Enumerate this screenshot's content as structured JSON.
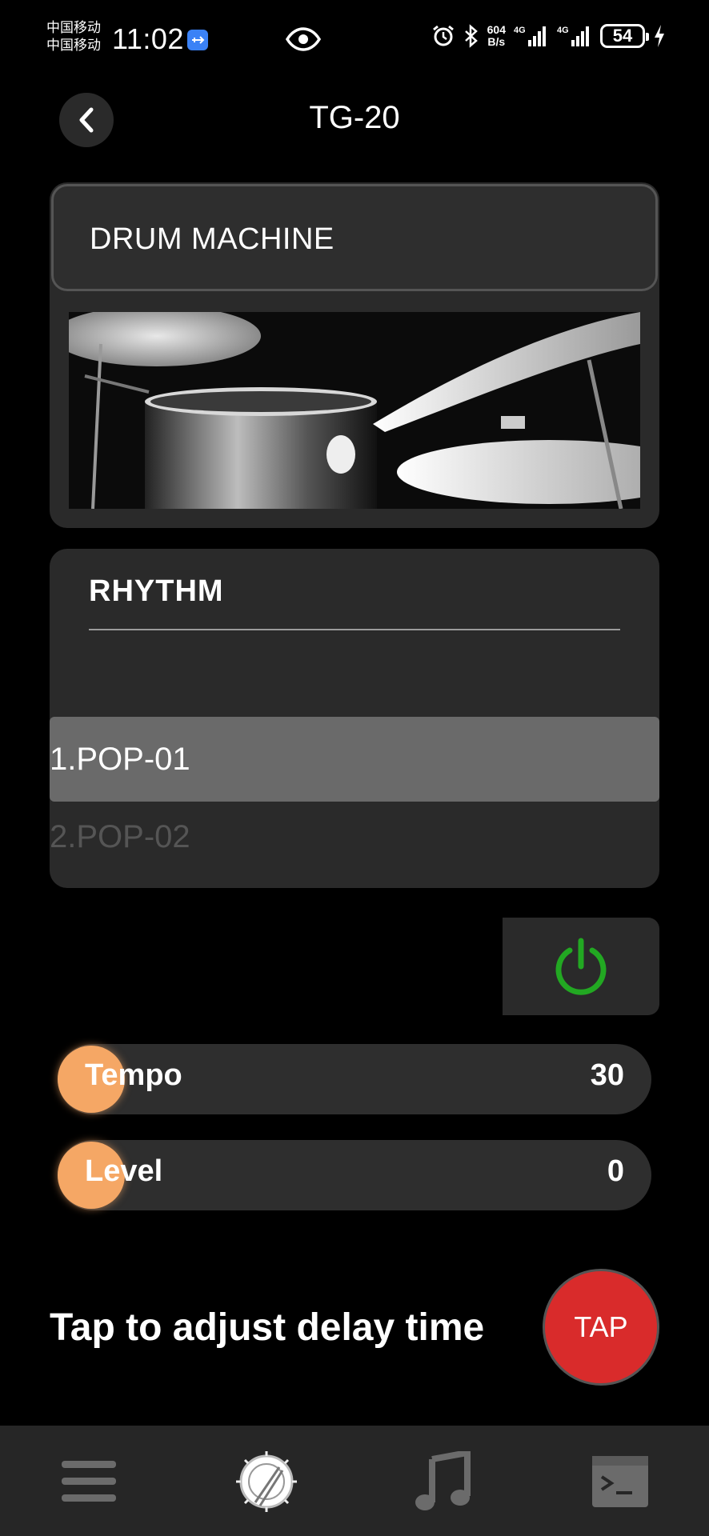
{
  "status_bar": {
    "carrier_1": "中国移动",
    "carrier_2": "中国移动",
    "time": "11:02",
    "net_speed_value": "604",
    "net_speed_unit": "B/s",
    "signal_1": "4G",
    "signal_2": "4G",
    "battery": "54",
    "icons": [
      "usb-icon",
      "eye-icon",
      "alarm-icon",
      "bluetooth-icon",
      "signal-icon",
      "charging-icon"
    ]
  },
  "header": {
    "title": "TG-20",
    "back_icon": "chevron-left-icon"
  },
  "mode": {
    "label": "DRUM MACHINE"
  },
  "rhythm": {
    "title": "RHYTHM",
    "items": [
      {
        "label": "1.POP-01",
        "selected": true
      },
      {
        "label": "2.POP-02",
        "selected": false
      }
    ]
  },
  "power": {
    "icon": "power-icon",
    "state": "on",
    "color": "#22a822"
  },
  "sliders": {
    "tempo": {
      "label": "Tempo",
      "value": "30"
    },
    "level": {
      "label": "Level",
      "value": "0"
    }
  },
  "tap": {
    "caption": "Tap to adjust delay time",
    "button_label": "TAP",
    "color": "#d92b2b"
  },
  "bottom_nav": {
    "items": [
      "menu-icon",
      "drum-icon",
      "music-note-icon",
      "terminal-icon"
    ],
    "active": "drum-icon"
  },
  "colors": {
    "accent_knob": "#f5a765",
    "panel": "#2a2a2a",
    "background": "#000000"
  }
}
